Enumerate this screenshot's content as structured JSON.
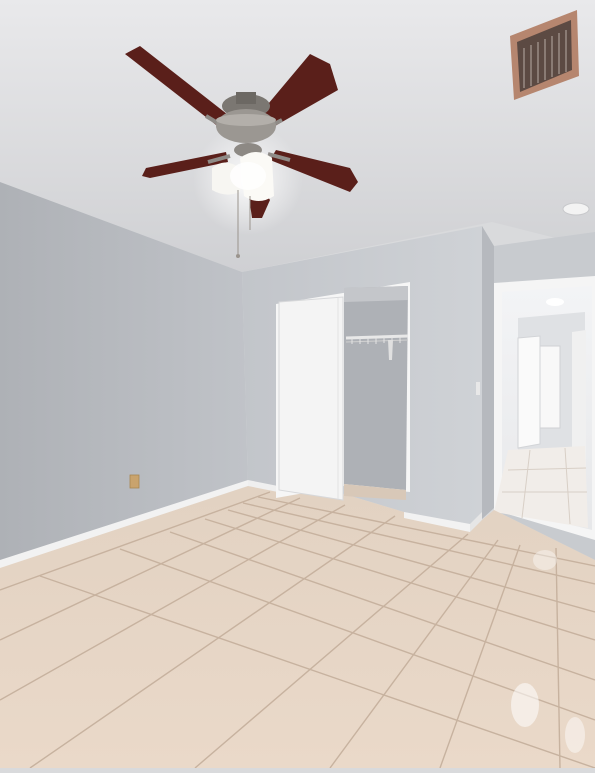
{
  "scene": {
    "description_hidden": "",
    "colors": {
      "ceiling": "#dcdde0",
      "wall_left": "#b9bcc1",
      "wall_back": "#c3c6cb",
      "wall_right": "#cfd1d5",
      "floor_tile": "#e6d6c6",
      "grout": "#c9b5a2",
      "baseboard": "#f4f4f4",
      "closet_door": "#f2f2f2",
      "fan_blade": "#5a1f1a",
      "fan_metal": "#8d8b88",
      "light_glass": "#f7f6f2"
    },
    "elements": {
      "ceiling_fan": "ceiling-fan-icon",
      "air_vent": "air-vent-icon",
      "smoke_detector": "smoke-detector-icon",
      "closet": "closet-door-icon",
      "hallway": "hallway-doorway-icon",
      "outlet": "wall-outlet-icon"
    }
  },
  "watermark": {
    "text": ""
  }
}
